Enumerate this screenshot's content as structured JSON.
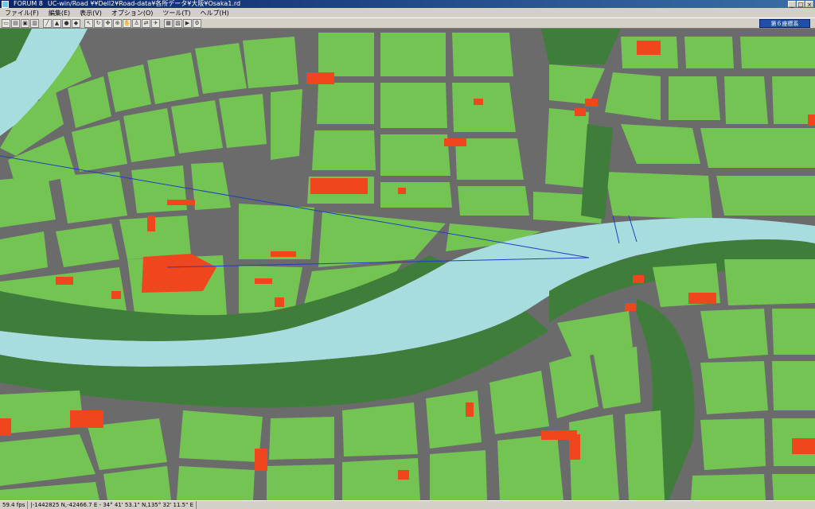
{
  "window": {
    "title_app": "FORUM 8",
    "title_path": "UC-win/Road    ¥¥Dell2¥Road-data¥各所データ¥大阪¥Osaka1.rd"
  },
  "menu": {
    "file": "ファイル(F)",
    "edit": "編集(E)",
    "view": "表示(V)",
    "options": "オプション(O)",
    "tools": "ツール(T)",
    "help": "ヘルプ(H)"
  },
  "toolbar": {
    "view_coords_button": "第６座標系",
    "icons": [
      "new-icon",
      "open-icon",
      "save-icon",
      "print-icon",
      "road-icon",
      "terrain-icon",
      "traffic-icon",
      "marker-icon",
      "select-icon",
      "rotate-icon",
      "move-icon",
      "zoom-icon",
      "pan-icon",
      "walk-icon",
      "drive-icon",
      "fly-icon",
      "camera-icon",
      "chart-icon",
      "run-icon",
      "settings-icon"
    ]
  },
  "status": {
    "fps": "59.4 fps",
    "coordinates": "|-1442825 N,-42466.7 E  -  34° 41' 53.1\" N,135° 32' 11.5\" E"
  },
  "colors": {
    "road": "#6b6b6b",
    "block": "#74c453",
    "park": "#3f7d3a",
    "river": "#a8dde0",
    "building": "#f0461e"
  }
}
